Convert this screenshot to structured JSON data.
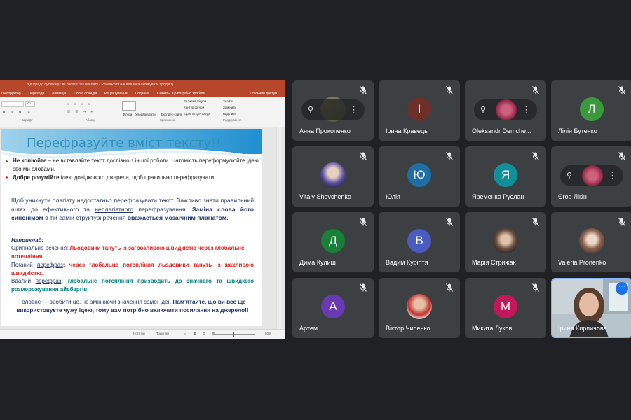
{
  "presentation": {
    "title_bar": "Від ідеї до публікації: як писати без плагіату - PowerPoint (не вдалося активувати продукт)",
    "menu": [
      "Конструктор",
      "Переходи",
      "Анімація",
      "Показ слайдів",
      "Рецензування",
      "Подання",
      "Скажіть, що потрібно зробити..."
    ],
    "share_label": "Спільний доступ",
    "ribbon": {
      "font_size": "20",
      "groups": [
        "Шрифт",
        "Абзац",
        "Креслення",
        "Редагування"
      ],
      "buttons": {
        "shapes": "Фігури",
        "arrange": "Упорядкувати",
        "quick_styles": "Експрес-стилі",
        "shape_fill": "Заливка фігури",
        "shape_outline": "Контур фігури",
        "shape_effects": "Ефекти для фігур",
        "find": "Знайти",
        "replace": "Замінити",
        "select": "Виділити"
      }
    },
    "slide": {
      "title": "Перефразуйте вміст тексту!!",
      "b1_bold": "Не копіюйте",
      "b1_rest": " – не вставляйте текст дослівно з іншої роботи. Натомість переформулюйте ідею своїми словами.",
      "b2_bold": "Добре розумійте",
      "b2_rest": " ідею довідкового джерела, щоб правильно перефразувати.",
      "p1_a": "Щоб уникнути плагіату недостатньо перефразувати текст. Важливо знати правильний шлях до ефективного та ",
      "p1_ul": "неплагіатного",
      "p1_b": " перефразування. ",
      "p1_bold": "Заміна слова його синонімом",
      "p1_c": " в тій самій структурі речення ",
      "p1_bold2": "вважається мозаїчним плагіатом.",
      "example_label": "Наприклад:",
      "orig_label": "Оригінальне речення: ",
      "orig_text": "Льодовики тануть із загрозливою швидкістю через глобальне потепління.",
      "bad_label": "Поганий ",
      "bad_label_ul": "перефраз",
      "bad_text": ": через глобальне потепління льодовики тануть із жахливою швидкістю.",
      "good_label": "Вдалий ",
      "good_label_ul": "перефраз",
      "good_text": ": глобальне потепління призводить до значного та швидкого розморожування айсбергів.",
      "conclusion_a": "Головне — зробити це, не змінюючи значення самої ідеї. ",
      "conclusion_bold": "Пам’ятайте, що ви все ще використовуєте чужу ідею, тому вам потрібно включити посилання на джерело!!"
    },
    "status": {
      "notes": "Нотатки",
      "comments": "Примітки",
      "zoom": "80%"
    }
  },
  "participants": [
    {
      "name": "Анна Прокопенко",
      "initial": "",
      "type": "pinned-photo",
      "color": "#7a6b4f"
    },
    {
      "name": "Ірина Кравець",
      "initial": "І",
      "type": "initial",
      "color": "#6d2f2a"
    },
    {
      "name": "Oleksandr Demche...",
      "initial": "",
      "type": "pinned-photo",
      "color": "#b04060"
    },
    {
      "name": "Лілія Бутенко",
      "initial": "Л",
      "type": "initial",
      "color": "#3a9a3a"
    },
    {
      "name": "Vitaly Shevchenko",
      "initial": "",
      "type": "photo",
      "color": "#5a4fa0"
    },
    {
      "name": "Юлія",
      "initial": "Ю",
      "type": "initial",
      "color": "#1e6fa8"
    },
    {
      "name": "Яременко Руслан",
      "initial": "Я",
      "type": "initial",
      "color": "#0f8f9a"
    },
    {
      "name": "Єгор Лікін",
      "initial": "",
      "type": "pinned-photo",
      "color": "#b04060"
    },
    {
      "name": "Дима Кулиш",
      "initial": "Д",
      "type": "initial",
      "color": "#188038"
    },
    {
      "name": "Вадим Куріптя",
      "initial": "В",
      "type": "initial",
      "color": "#4a5bc2"
    },
    {
      "name": "Марія Стрижак",
      "initial": "",
      "type": "photo",
      "color": "#8a6a4a"
    },
    {
      "name": "Valeria Pronenko",
      "initial": "",
      "type": "photo",
      "color": "#6a5040"
    },
    {
      "name": "Артем",
      "initial": "А",
      "type": "initial",
      "color": "#6a3ab5"
    },
    {
      "name": "Віктор Чипенко",
      "initial": "",
      "type": "photo",
      "color": "#b03030"
    },
    {
      "name": "Микита Луков",
      "initial": "М",
      "type": "initial",
      "color": "#c2185b"
    },
    {
      "name": "Ірина Кирпичова",
      "initial": "",
      "type": "self-video",
      "color": "#b8c4cc"
    }
  ],
  "icons": {
    "mute": "mic-off-icon",
    "pin": "pin-icon",
    "more": "more-vert-icon"
  }
}
